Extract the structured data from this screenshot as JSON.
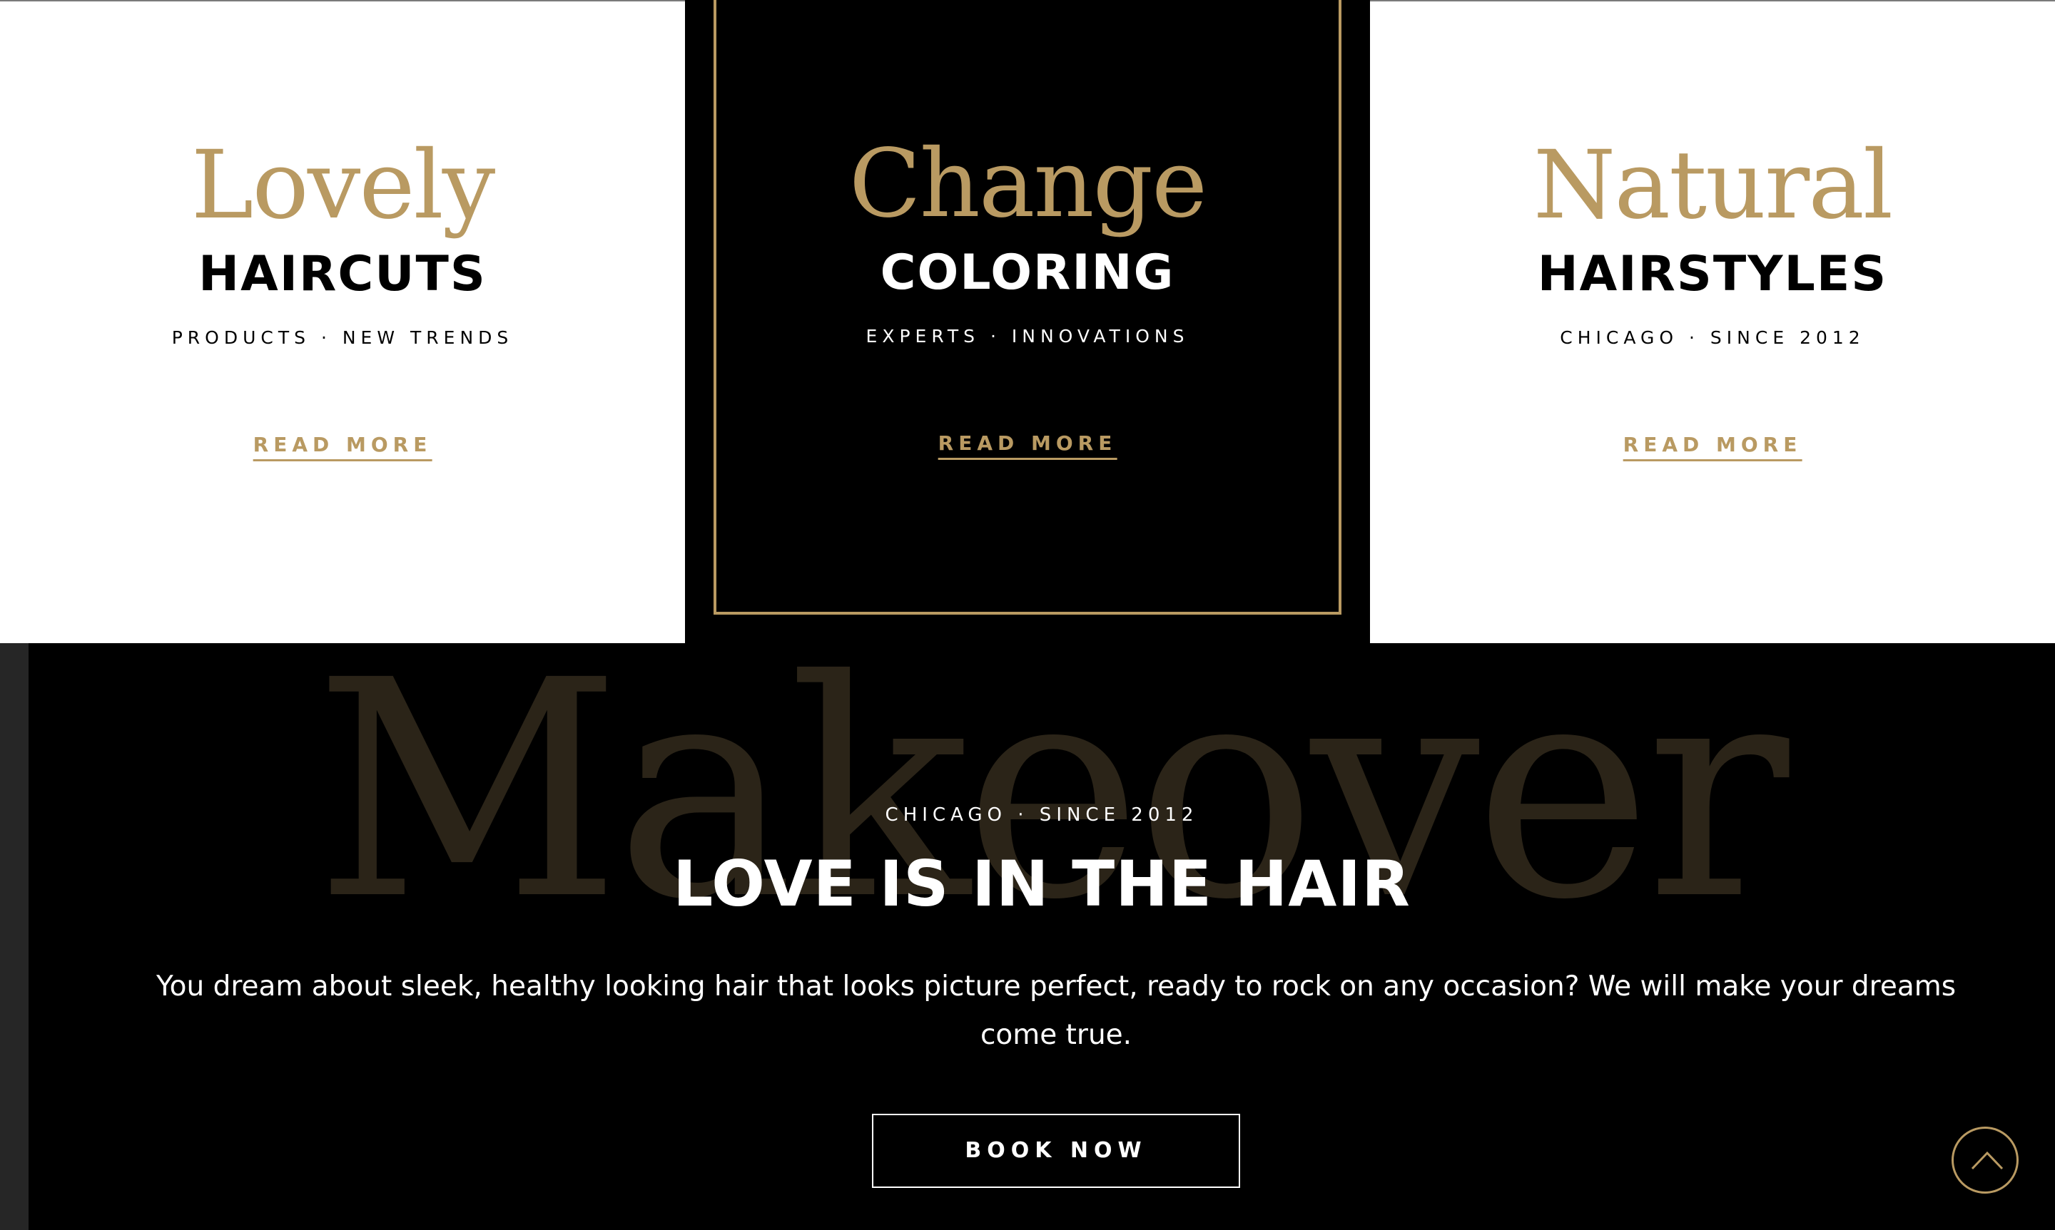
{
  "cards": [
    {
      "script": "Lovely",
      "heading": "HAIRCUTS",
      "tagline": "PRODUCTS · NEW TRENDS",
      "link_label": "READ MORE"
    },
    {
      "script": "Change",
      "heading": "COLORING",
      "tagline": "EXPERTS · INNOVATIONS",
      "link_label": "READ MORE"
    },
    {
      "script": "Natural",
      "heading": "HAIRSTYLES",
      "tagline": "CHICAGO · SINCE 2012",
      "link_label": "READ MORE"
    }
  ],
  "hero": {
    "background_word": "Makeover",
    "eyebrow": "CHICAGO · SINCE 2012",
    "title": "LOVE IS IN THE HAIR",
    "description": "You dream about sleek, healthy looking hair that looks picture perfect, ready to rock on any occasion? We will make your dreams come true.",
    "cta_label": "BOOK NOW"
  },
  "scroll_top": {
    "icon": "chevron-up-icon"
  },
  "colors": {
    "accent_gold": "#b99a62",
    "background_dark": "#000000",
    "card_light": "#ffffff",
    "watermark": "#2b2418"
  }
}
